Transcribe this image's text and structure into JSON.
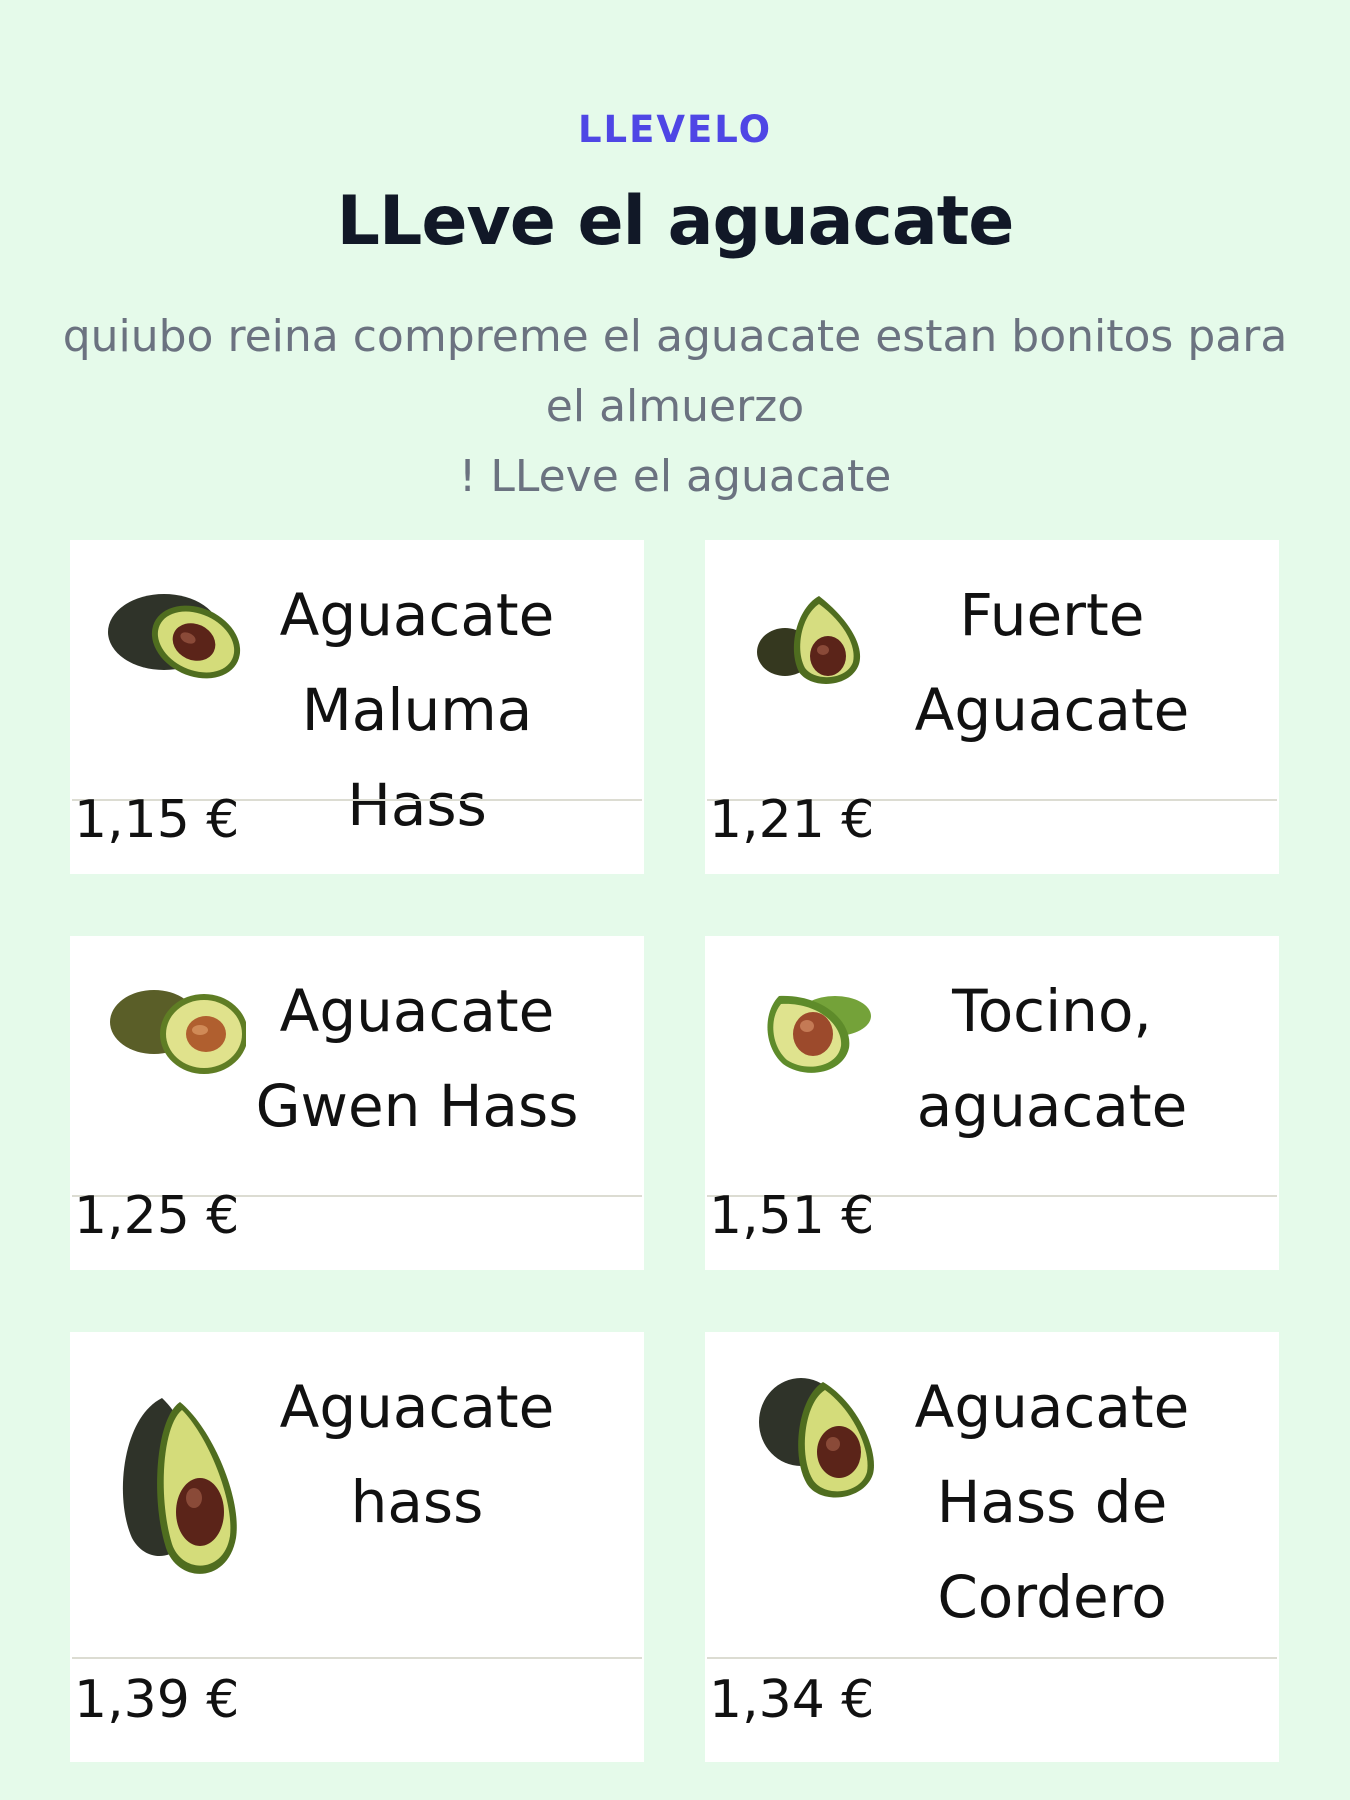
{
  "header": {
    "eyebrow": "LLEVELO",
    "title": "LLeve el aguacate",
    "subtitle_line1": "quiubo reina compreme el aguacate estan bonitos para",
    "subtitle_line2": "el almuerzo",
    "subtitle_line3": "! LLeve el aguacate"
  },
  "products": [
    {
      "name": "Aguacate Maluma Hass",
      "price": "1,15 €",
      "image_icon": "avocado-half-icon"
    },
    {
      "name": "Fuerte Aguacate",
      "price": "1,21 €",
      "image_icon": "avocado-half-icon"
    },
    {
      "name": "Aguacate Gwen Hass",
      "price": "1,25 €",
      "image_icon": "avocado-pair-icon"
    },
    {
      "name": "Tocino, aguacate",
      "price": "1,51 €",
      "image_icon": "avocado-pair-icon"
    },
    {
      "name": "Aguacate hass",
      "price": "1,39 €",
      "image_icon": "avocado-half-icon"
    },
    {
      "name": "Aguacate Hass de Cordero",
      "price": "1,34 €",
      "image_icon": "avocado-half-icon"
    }
  ]
}
